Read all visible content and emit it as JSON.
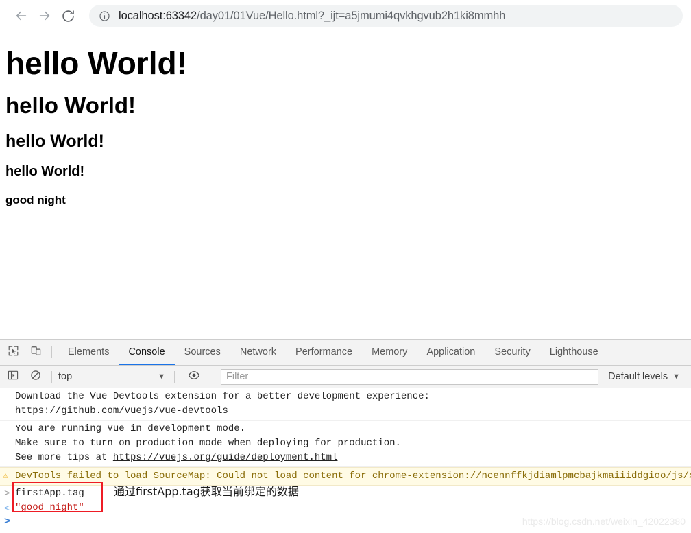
{
  "browser": {
    "back_icon": "arrow-left-icon",
    "forward_icon": "arrow-right-icon",
    "reload_icon": "reload-icon",
    "info_icon": "info-circle-icon",
    "url_host": "localhost:63342",
    "url_path": "/day01/01Vue/Hello.html?_ijt=a5jmumi4qvkhgvub2h1ki8mmhh",
    "url_full": "localhost:63342/day01/01Vue/Hello.html?_ijt=a5jmumi4qvkhgvub2h1ki8mmhh"
  },
  "page": {
    "headings": [
      {
        "level": "h1",
        "text": "hello World!"
      },
      {
        "level": "h2",
        "text": "hello World!"
      },
      {
        "level": "h3",
        "text": "hello World!"
      },
      {
        "level": "h4",
        "text": "hello World!"
      },
      {
        "level": "h5",
        "text": "good night"
      }
    ]
  },
  "devtools": {
    "inspect_icon": "inspect-element-icon",
    "device_icon": "device-toolbar-icon",
    "tabs": [
      {
        "label": "Elements",
        "active": false
      },
      {
        "label": "Console",
        "active": true
      },
      {
        "label": "Sources",
        "active": false
      },
      {
        "label": "Network",
        "active": false
      },
      {
        "label": "Performance",
        "active": false
      },
      {
        "label": "Memory",
        "active": false
      },
      {
        "label": "Application",
        "active": false
      },
      {
        "label": "Security",
        "active": false
      },
      {
        "label": "Lighthouse",
        "active": false
      }
    ],
    "toolbar": {
      "sidebar_icon": "console-sidebar-icon",
      "clear_icon": "clear-console-icon",
      "eye_icon": "live-expression-eye-icon",
      "context": "top",
      "context_caret": "▼",
      "filter_placeholder": "Filter",
      "filter_value": "",
      "levels": "Default levels",
      "levels_caret": "▼"
    },
    "messages": [
      {
        "type": "log",
        "lines": [
          {
            "text": "Download the Vue Devtools extension for a better development experience:",
            "link": false
          },
          {
            "text": "https://github.com/vuejs/vue-devtools",
            "link": true
          }
        ]
      },
      {
        "type": "log",
        "lines": [
          {
            "text": "You are running Vue in development mode.",
            "link": false
          },
          {
            "text": "Make sure to turn on production mode when deploying for production.",
            "link": false
          },
          {
            "text": "See more tips at ",
            "link": false,
            "tail_link": "https://vuejs.org/guide/deployment.html"
          }
        ]
      },
      {
        "type": "warning",
        "icon": "warning-triangle-icon",
        "text": "DevTools failed to load SourceMap: Could not load content for ",
        "link": "chrome-extension://ncennffkjdiamlpmcbajkmaiiiddgioo/js/xl"
      }
    ],
    "evaluation": {
      "input_gutter": ">",
      "input_text": "firstApp.tag",
      "output_gutter": "<",
      "output_text": "\"good night\""
    },
    "prompt_chevron": ">"
  },
  "annotation": {
    "text": "通过firstApp.tag获取当前绑定的数据"
  },
  "watermark": {
    "text": "https://blog.csdn.net/weixin_42022380"
  },
  "colors": {
    "accent": "#1a73e8",
    "warning_bg": "#fffbe5",
    "warning_text": "#8a6d09",
    "result_string": "#c41a16",
    "highlight_box": "#ee1c25"
  }
}
